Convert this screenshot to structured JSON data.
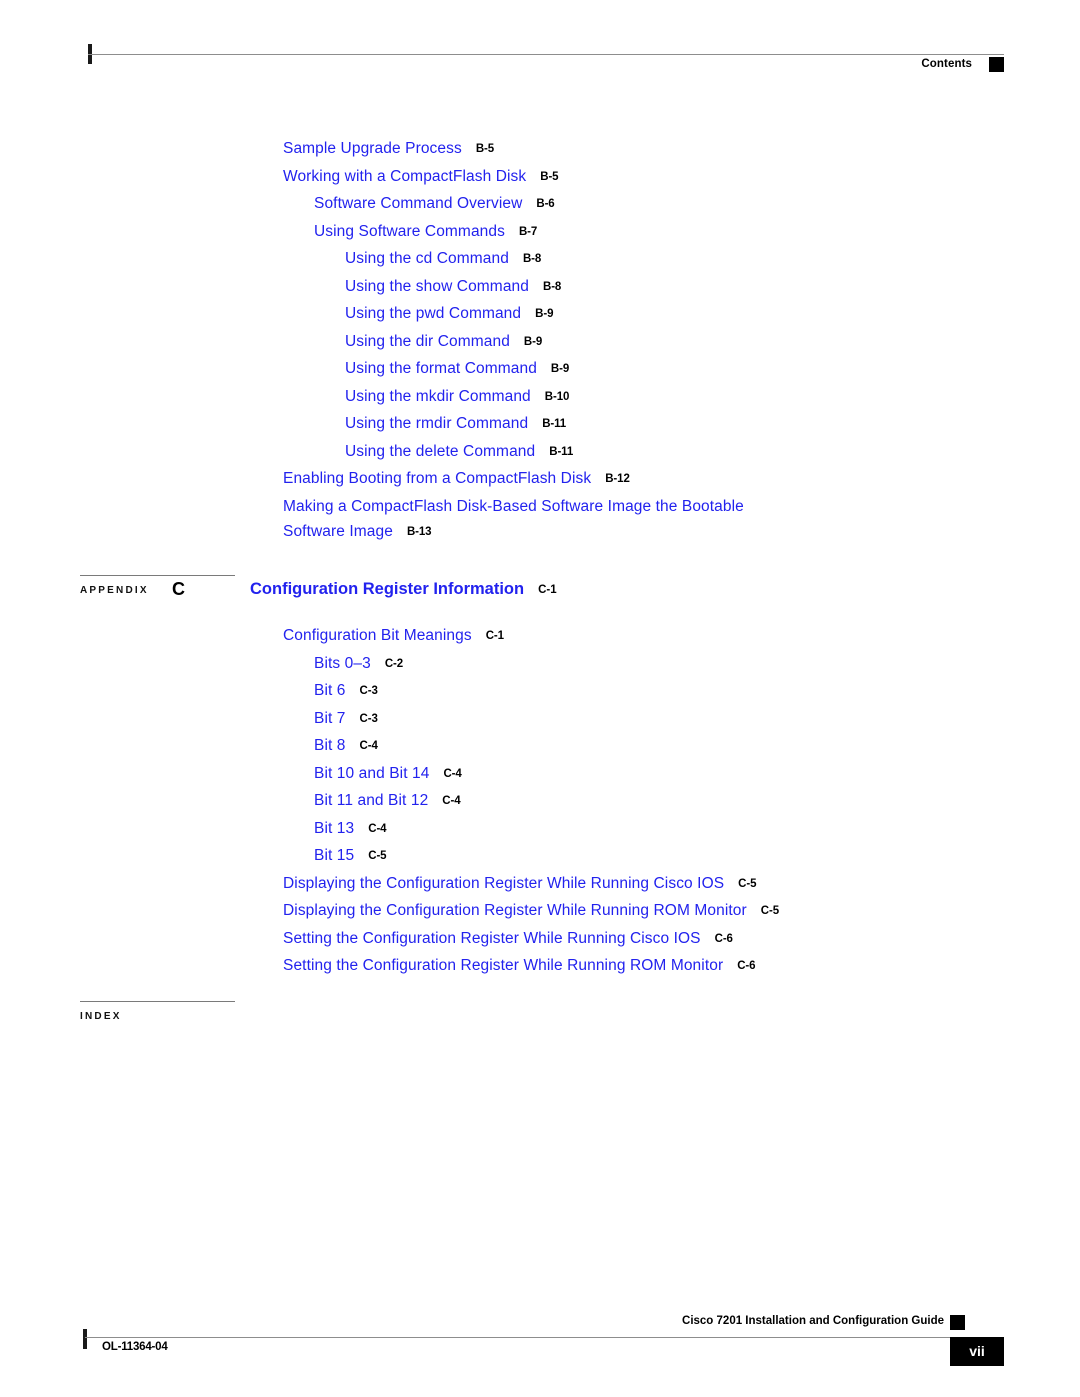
{
  "header": {
    "label": "Contents"
  },
  "toc": {
    "entries": [
      {
        "level": 1,
        "title": "Sample Upgrade Process",
        "page": "B-5"
      },
      {
        "level": 1,
        "title": "Working with a CompactFlash Disk",
        "page": "B-5"
      },
      {
        "level": 2,
        "title": "Software Command Overview",
        "page": "B-6"
      },
      {
        "level": 2,
        "title": "Using Software Commands",
        "page": "B-7"
      },
      {
        "level": 3,
        "title": "Using the cd Command",
        "page": "B-8"
      },
      {
        "level": 3,
        "title": "Using the show Command",
        "page": "B-8"
      },
      {
        "level": 3,
        "title": "Using the pwd Command",
        "page": "B-9"
      },
      {
        "level": 3,
        "title": "Using the dir Command",
        "page": "B-9"
      },
      {
        "level": 3,
        "title": "Using the format Command",
        "page": "B-9"
      },
      {
        "level": 3,
        "title": "Using the mkdir Command",
        "page": "B-10"
      },
      {
        "level": 3,
        "title": "Using the rmdir Command",
        "page": "B-11"
      },
      {
        "level": 3,
        "title": "Using the delete Command",
        "page": "B-11"
      },
      {
        "level": 1,
        "title": "Enabling Booting from a CompactFlash Disk",
        "page": "B-12"
      },
      {
        "level": 1,
        "title": "Making a CompactFlash Disk-Based Software Image the Bootable",
        "page": "",
        "continuation": "Software Image",
        "continuation_page": "B-13"
      }
    ]
  },
  "appendix": {
    "word": "APPENDIX",
    "letter": "C",
    "title": "Configuration Register Information",
    "page": "C-1",
    "entries": [
      {
        "level": 1,
        "title": "Configuration Bit Meanings",
        "page": "C-1"
      },
      {
        "level": 2,
        "title": "Bits 0–3",
        "page": "C-2"
      },
      {
        "level": 2,
        "title": "Bit 6",
        "page": "C-3"
      },
      {
        "level": 2,
        "title": "Bit 7",
        "page": "C-3"
      },
      {
        "level": 2,
        "title": "Bit 8",
        "page": "C-4"
      },
      {
        "level": 2,
        "title": "Bit 10 and Bit 14",
        "page": "C-4"
      },
      {
        "level": 2,
        "title": "Bit 11 and Bit 12",
        "page": "C-4"
      },
      {
        "level": 2,
        "title": "Bit 13",
        "page": "C-4"
      },
      {
        "level": 2,
        "title": "Bit 15",
        "page": "C-5"
      },
      {
        "level": 1,
        "title": "Displaying the Configuration Register While Running Cisco IOS",
        "page": "C-5"
      },
      {
        "level": 1,
        "title": "Displaying the Configuration Register While Running ROM Monitor",
        "page": "C-5"
      },
      {
        "level": 1,
        "title": "Setting the Configuration Register While Running Cisco IOS",
        "page": "C-6"
      },
      {
        "level": 1,
        "title": "Setting the Configuration Register While Running ROM Monitor",
        "page": "C-6"
      }
    ]
  },
  "index": {
    "word": "INDEX"
  },
  "footer": {
    "guide": "Cisco 7201 Installation and Configuration Guide",
    "doc_id": "OL-11364-04",
    "page_number": "vii"
  },
  "colors": {
    "link_blue": "#2222ee",
    "rule_gray": "#8d8d8d",
    "marker_black": "#000000"
  }
}
